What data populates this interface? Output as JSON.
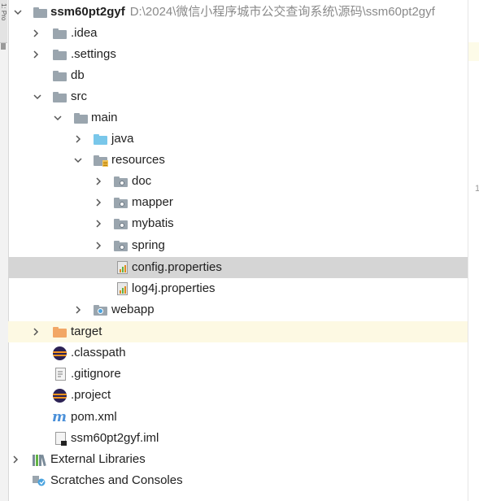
{
  "left_strip": {
    "tab_label": "1: Pro"
  },
  "editor": {
    "line_number": "1"
  },
  "tree": {
    "rows": [
      {
        "label": "ssm60pt2gyf",
        "path": "D:\\2024\\微信小程序城市公交查询系统\\源码\\ssm60pt2gyf",
        "icon": "module-folder-icon"
      },
      {
        "label": ".idea",
        "icon": "folder-icon"
      },
      {
        "label": ".settings",
        "icon": "folder-icon"
      },
      {
        "label": "db",
        "icon": "folder-icon"
      },
      {
        "label": "src",
        "icon": "folder-icon"
      },
      {
        "label": "main",
        "icon": "folder-icon"
      },
      {
        "label": "java",
        "icon": "source-folder-icon"
      },
      {
        "label": "resources",
        "icon": "resources-folder-icon"
      },
      {
        "label": "doc",
        "icon": "package-folder-icon"
      },
      {
        "label": "mapper",
        "icon": "package-folder-icon"
      },
      {
        "label": "mybatis",
        "icon": "package-folder-icon"
      },
      {
        "label": "spring",
        "icon": "package-folder-icon"
      },
      {
        "label": "config.properties",
        "icon": "properties-file-icon"
      },
      {
        "label": "log4j.properties",
        "icon": "properties-file-icon"
      },
      {
        "label": "webapp",
        "icon": "web-folder-icon"
      },
      {
        "label": "target",
        "icon": "excluded-folder-icon"
      },
      {
        "label": ".classpath",
        "icon": "eclipse-file-icon"
      },
      {
        "label": ".gitignore",
        "icon": "text-file-icon"
      },
      {
        "label": ".project",
        "icon": "eclipse-file-icon"
      },
      {
        "label": "pom.xml",
        "icon": "maven-file-icon"
      },
      {
        "label": "ssm60pt2gyf.iml",
        "icon": "iml-file-icon"
      },
      {
        "label": "External Libraries",
        "icon": "libraries-icon"
      },
      {
        "label": "Scratches and Consoles",
        "icon": "scratches-icon"
      }
    ]
  },
  "colors": {
    "selection": "#d5d5d5",
    "excluded_highlight": "#fdf9e3",
    "path_text": "#8a8a8a",
    "folder_grey": "#9aa5ae",
    "source_blue": "#79c7ea",
    "excluded_orange": "#f2a766"
  }
}
